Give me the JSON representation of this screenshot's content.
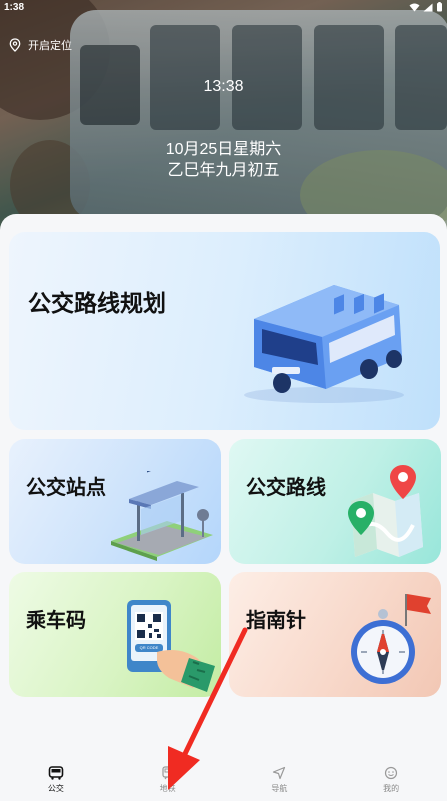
{
  "status_bar": {
    "time": "1:38"
  },
  "location": {
    "label": "开启定位"
  },
  "clock": {
    "time": "13:38",
    "date": "10月25日星期六",
    "lunar": "乙巳年九月初五"
  },
  "cards": {
    "plan": {
      "title": "公交路线规划"
    },
    "stop": {
      "title": "公交站点"
    },
    "route": {
      "title": "公交路线"
    },
    "code": {
      "title": "乘车码",
      "qr_caption": "QR CODE"
    },
    "compass": {
      "title": "指南针"
    }
  },
  "tabs": [
    {
      "label": "公交",
      "icon": "bus-icon",
      "active": true
    },
    {
      "label": "地铁",
      "icon": "subway-icon",
      "active": false
    },
    {
      "label": "导航",
      "icon": "navigation-icon",
      "active": false
    },
    {
      "label": "我的",
      "icon": "profile-icon",
      "active": false
    }
  ],
  "colors": {
    "annotation_arrow": "#f02b22",
    "text_primary": "#111111"
  }
}
